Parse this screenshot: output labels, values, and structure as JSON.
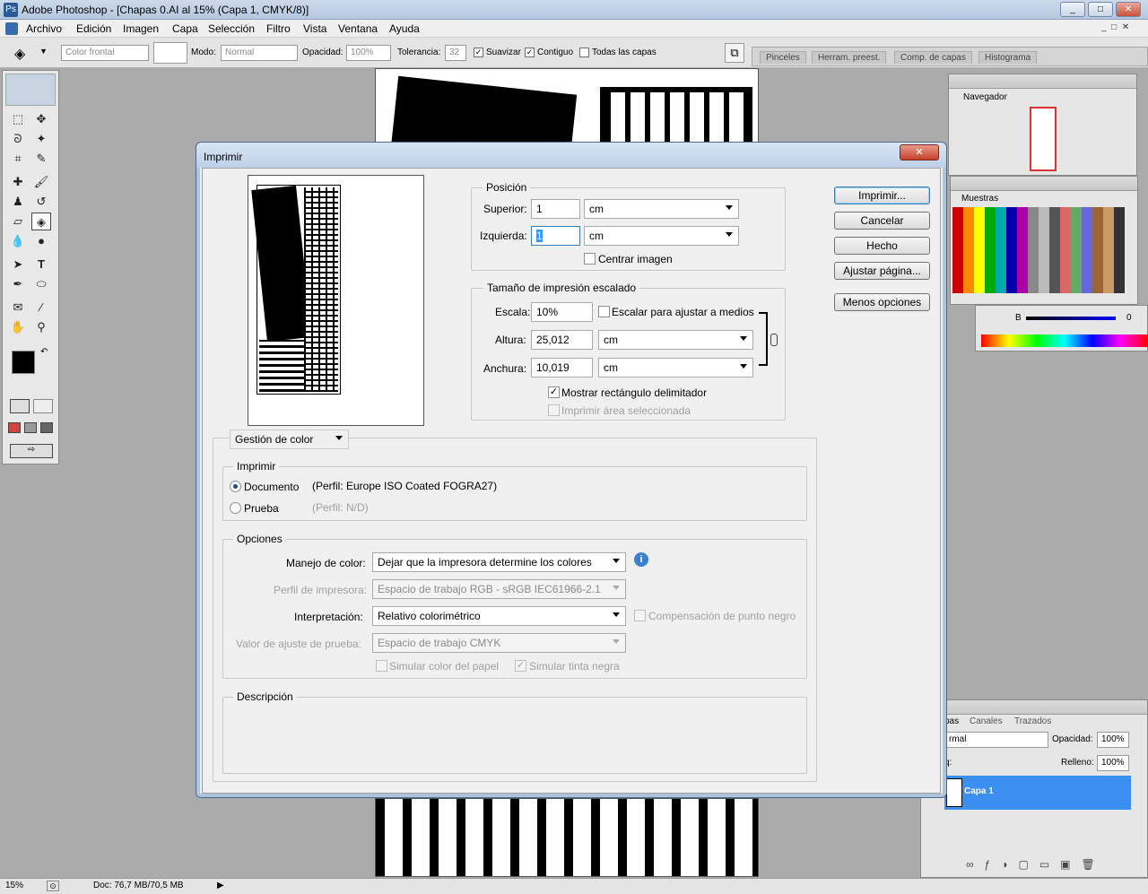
{
  "window": {
    "title": "Adobe Photoshop - [Chapas 0.AI al 15% (Capa 1, CMYK/8)]",
    "min": "_",
    "max": "□",
    "close": "✕"
  },
  "menu": [
    "Archivo",
    "Edición",
    "Imagen",
    "Capa",
    "Selección",
    "Filtro",
    "Vista",
    "Ventana",
    "Ayuda"
  ],
  "options": {
    "fill_source": "Color frontal",
    "mode_label": "Modo:",
    "mode_value": "Normal",
    "opacity_label": "Opacidad:",
    "opacity_value": "100%",
    "tolerance_label": "Tolerancia:",
    "tolerance_value": "32",
    "antialias": "Suavizar",
    "contiguous": "Contiguo",
    "all_layers": "Todas las capas"
  },
  "palette_tabs": [
    "Pinceles",
    "Herram. preest.",
    "Comp. de capas",
    "Histograma"
  ],
  "dialog": {
    "title": "Imprimir",
    "close": "✕",
    "position": {
      "legend": "Posición",
      "top_label": "Superior:",
      "top_value": "1",
      "top_unit": "cm",
      "left_label": "Izquierda:",
      "left_value": "1",
      "left_unit": "cm",
      "center_label": "Centrar imagen"
    },
    "scaled": {
      "legend": "Tamaño de impresión escalado",
      "scale_label": "Escala:",
      "scale_value": "10%",
      "fit_label": "Escalar para ajustar a medios",
      "height_label": "Altura:",
      "height_value": "25,012",
      "height_unit": "cm",
      "width_label": "Anchura:",
      "width_value": "10,019",
      "width_unit": "cm",
      "bbox_label": "Mostrar rectángulo delimitador",
      "selected_label": "Imprimir área seleccionada"
    },
    "buttons": {
      "print": "Imprimir...",
      "cancel": "Cancelar",
      "done": "Hecho",
      "page_setup": "Ajustar página...",
      "fewer": "Menos opciones"
    },
    "color_mgmt_select": "Gestión de color",
    "print_group": {
      "legend": "Imprimir",
      "document": "Documento",
      "document_profile": "(Perfil: Europe ISO Coated FOGRA27)",
      "proof": "Prueba",
      "proof_profile": "(Perfil: N/D)"
    },
    "options_group": {
      "legend": "Opciones",
      "color_handling_label": "Manejo de color:",
      "color_handling_value": "Dejar que la impresora determine los colores",
      "printer_profile_label": "Perfil de impresora:",
      "printer_profile_value": "Espacio de trabajo RGB - sRGB IEC61966-2.1",
      "intent_label": "Interpretación:",
      "intent_value": "Relativo colorimétrico",
      "black_point_label": "Compensación de punto negro",
      "proof_setup_label": "Valor de ajuste de prueba:",
      "proof_setup_value": "Espacio de trabajo CMYK",
      "sim_paper_label": "Simular color del papel",
      "sim_ink_label": "Simular tinta negra"
    },
    "description_legend": "Descripción"
  },
  "navigator": {
    "title": "Navegador"
  },
  "swatches": {
    "title": "Muestras"
  },
  "color": {
    "b_label": "B",
    "b_value": "0"
  },
  "layers": {
    "tab_layers": "pas",
    "tab_channels": "Canales",
    "tab_paths": "Trazados",
    "blend": "rmal",
    "opacity_label": "Opacidad:",
    "opacity_value": "100%",
    "fill_label": "Relleno:",
    "fill_value": "100%",
    "lock_label": "q:",
    "layer_name": "Capa 1"
  },
  "status": {
    "zoom": "15%",
    "doc": "Doc: 76,7 MB/70,5 MB"
  }
}
